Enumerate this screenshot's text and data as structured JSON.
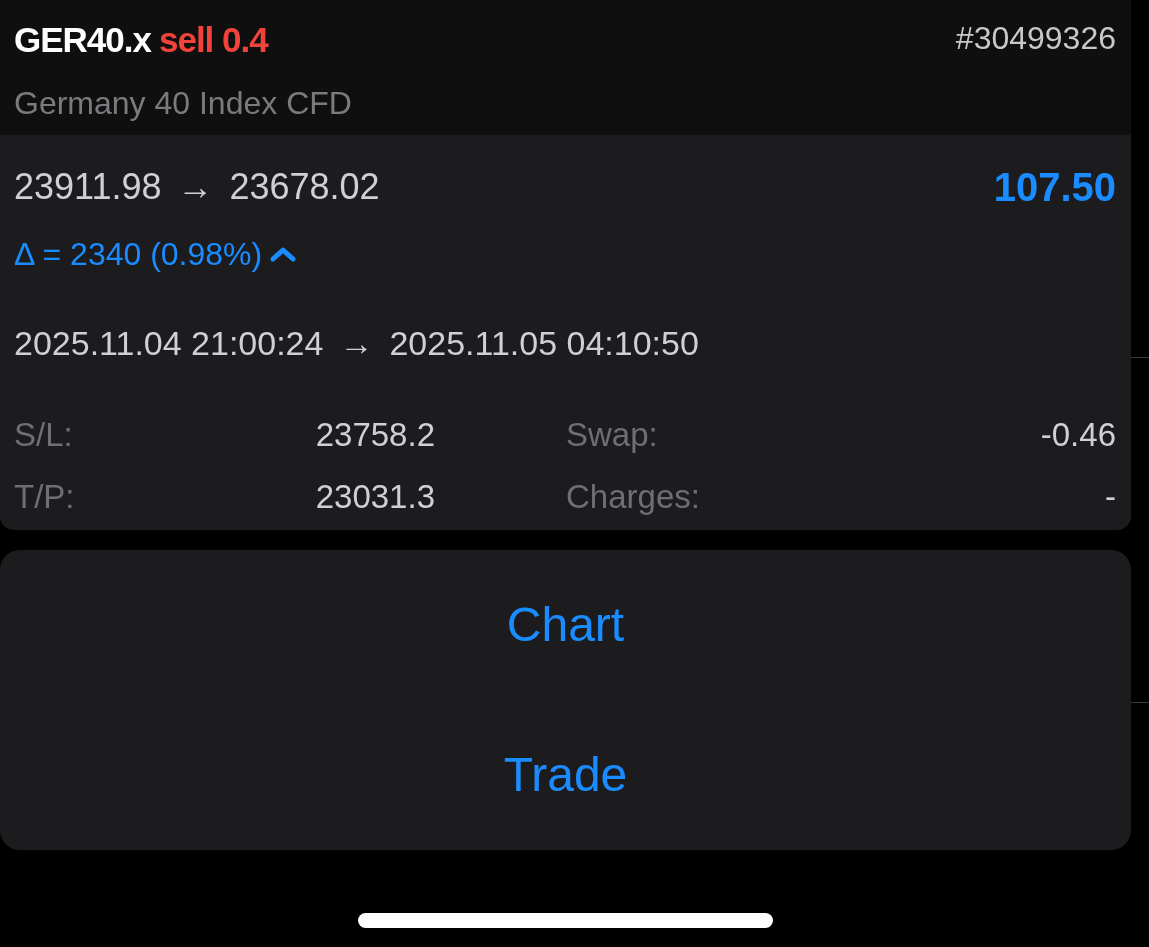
{
  "position": {
    "symbol": "GER40.x",
    "order_text": "sell 0.4",
    "ticket": "#30499326",
    "description": "Germany 40 Index CFD",
    "open_price": "23911.98",
    "price_arrow": "→",
    "close_price": "23678.02",
    "profit": "107.50",
    "delta": "Δ = 2340 (0.98%)",
    "delta_expanded": true,
    "open_time": "2025.11.04 21:00:24",
    "time_arrow": "→",
    "close_time": "2025.11.05 04:10:50",
    "fields": [
      {
        "label": "S/L:",
        "value": "23758.2"
      },
      {
        "label": "Swap:",
        "value": "-0.46"
      },
      {
        "label": "T/P:",
        "value": "23031.3"
      },
      {
        "label": "Charges:",
        "value": "-"
      }
    ]
  },
  "actions": [
    {
      "label": "Chart"
    },
    {
      "label": "Trade"
    }
  ]
}
